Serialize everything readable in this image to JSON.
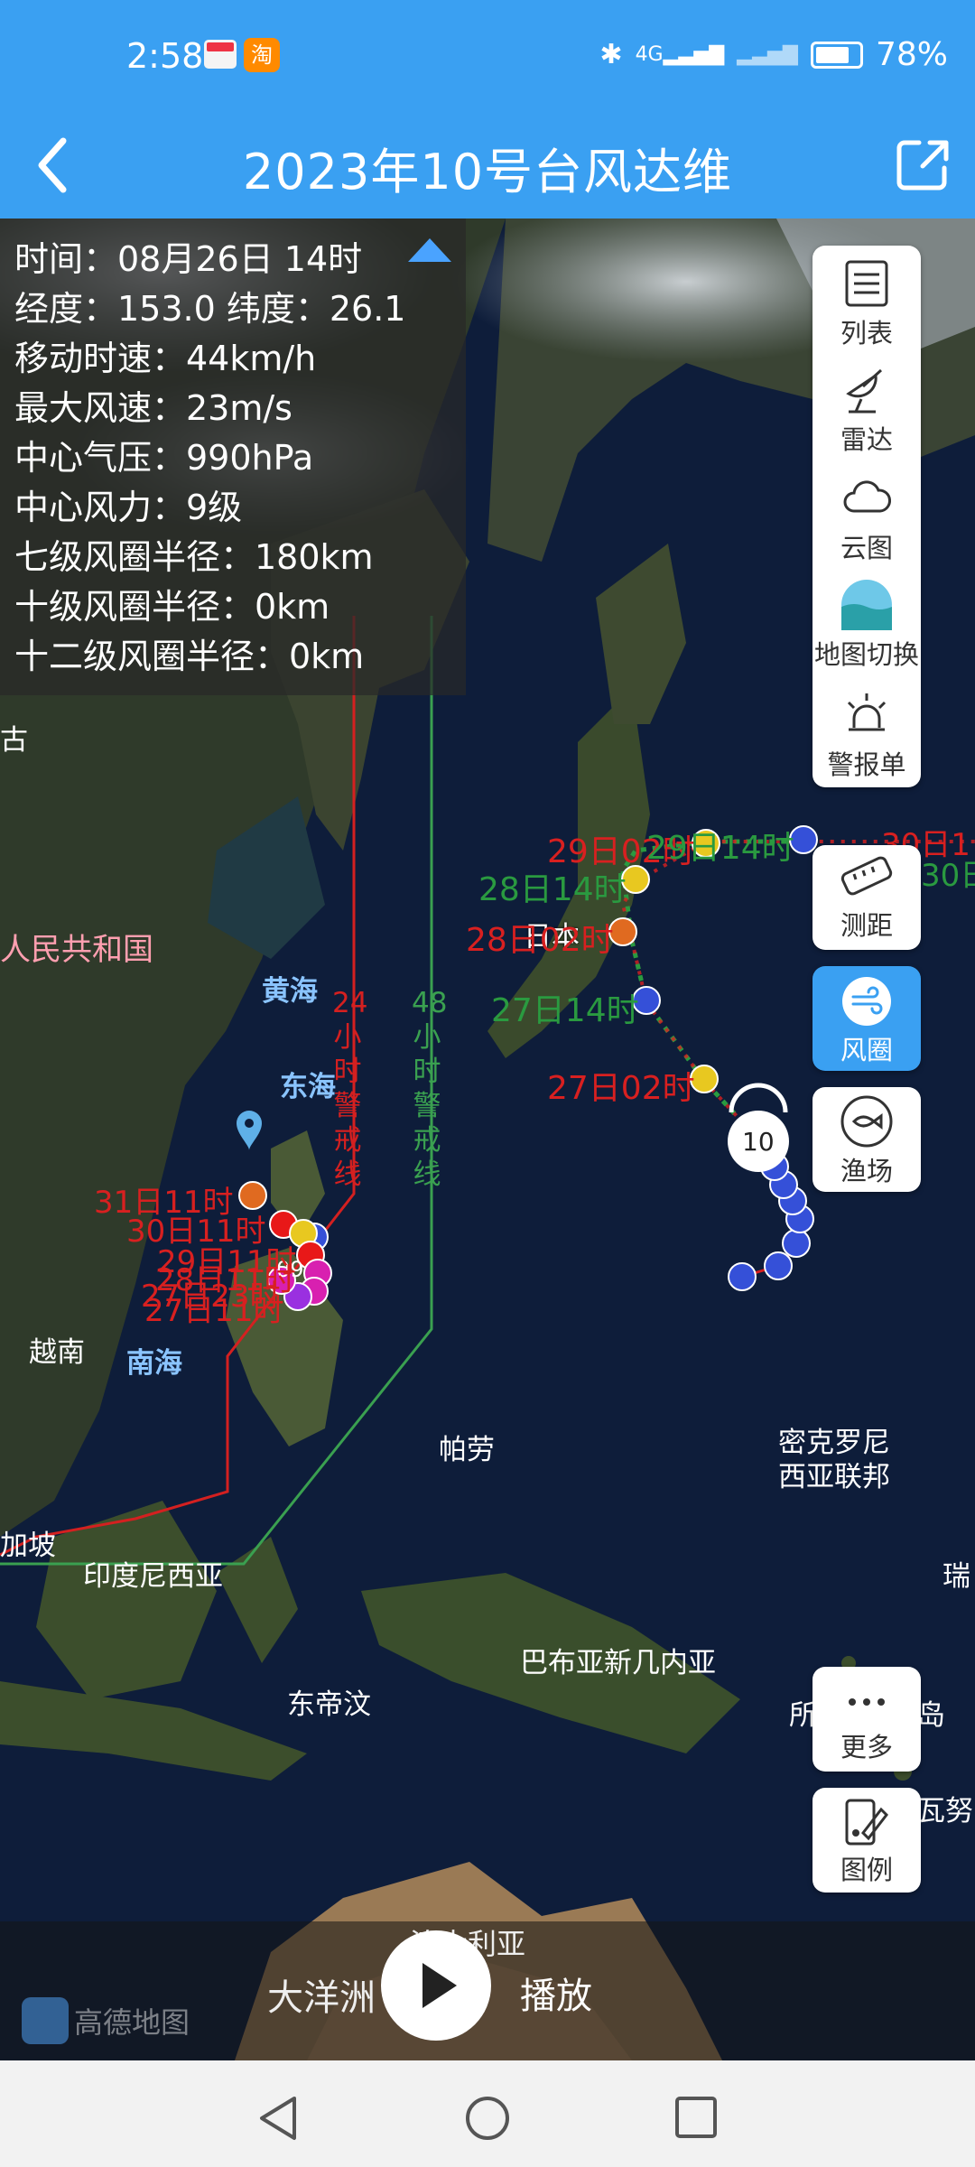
{
  "status_bar": {
    "time": "2:58",
    "network": "4G",
    "battery": "78%",
    "app_icon_1": "calendar-app-icon",
    "app_icon_2_text": "淘"
  },
  "header": {
    "title": "2023年10号台风达维",
    "back_icon": "back-arrow-icon",
    "share_icon": "share-icon"
  },
  "info_panel": {
    "time": "时间：08月26日 14时",
    "position": "经度：153.0 纬度：26.1",
    "move_speed": "移动时速：44km/h",
    "max_wind": "最大风速：23m/s",
    "pressure": "中心气压：990hPa",
    "wind_force": "中心风力：9级",
    "r7": "七级风圈半径：180km",
    "r10": "十级风圈半径：0km",
    "r12": "十二级风圈半径：0km"
  },
  "tools": {
    "list": "列表",
    "radar": "雷达",
    "cloud": "云图",
    "map_switch": "地图切换",
    "alert": "警报单",
    "measure": "测距",
    "wind_circle": "风圈",
    "fishery": "渔场",
    "more": "更多",
    "legend": "图例"
  },
  "map_labels": {
    "china_cut": "人民共和国",
    "mongolia_cut": "古",
    "yellow_sea": "黄海",
    "east_sea": "东海",
    "south_sea": "南海",
    "vietnam": "越南",
    "palau": "帕劳",
    "micronesia_1": "密克罗尼",
    "micronesia_2": "西亚联邦",
    "indonesia": "印度尼西亚",
    "singapore_cut": "加坡",
    "png": "巴布亚新几内亚",
    "timor": "东帝汶",
    "solomon_cut": "所",
    "island_cut": "岛",
    "vanuatu_cut": "瓦努",
    "ruirui_cut": "瑞",
    "japan": "日本",
    "line24_text": "24小时警戒线",
    "line24_num": "24",
    "line48_num": "48",
    "line48_text": "48小时警戒线",
    "typhoon_no": "10",
    "typhoon_no_2": "09"
  },
  "track_labels": {
    "t1": "29日02时",
    "t2": "29日14时",
    "t3": "30日1",
    "t3b": "30日",
    "t4": "28日14时",
    "t5": "28日02时",
    "t6": "27日14时",
    "t7": "27日02时",
    "w1": "31日11时",
    "w2": "30日11时",
    "w3": "29日11时",
    "w4": "28日11时",
    "w5": "27日23时",
    "w6": "27日11时"
  },
  "playbar": {
    "play_label": "播放",
    "ocean": "大洋洲",
    "australia": "澳大利亚",
    "map_provider": "高德地图"
  },
  "colors": {
    "accent": "#3aa0f2",
    "warn24": "#d42020",
    "warn48": "#3aa050",
    "forecast_red": "#d82020",
    "forecast_green": "#2a9a40"
  }
}
